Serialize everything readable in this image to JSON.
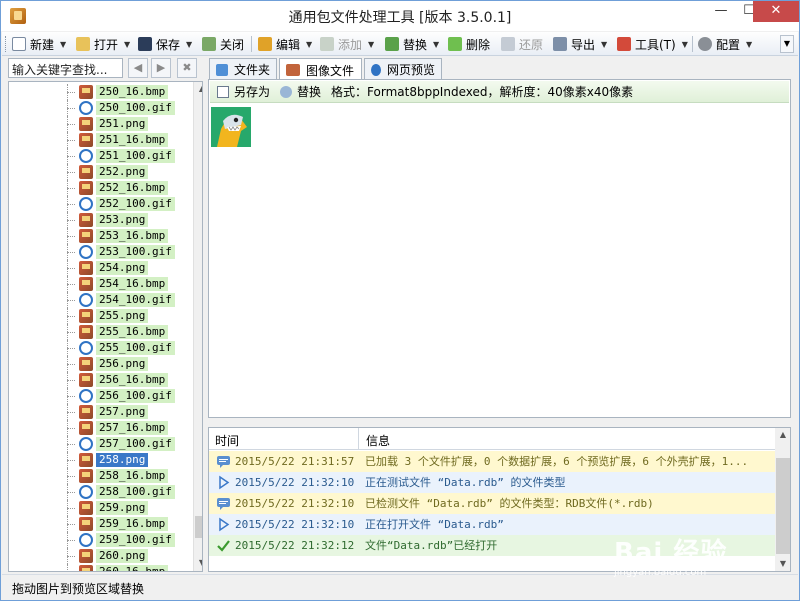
{
  "window": {
    "title": "通用包文件处理工具 [版本 3.5.0.1]",
    "minimize_glyph": "—",
    "maximize_glyph": "☐",
    "close_glyph": "✕"
  },
  "toolbar": {
    "new": "新建",
    "open": "打开",
    "save": "保存",
    "close": "关闭",
    "edit": "编辑",
    "add": "添加",
    "replace": "替换",
    "delete": "删除",
    "restore": "还原",
    "export": "导出",
    "tools": "工具(T)",
    "config": "配置",
    "dropdown_glyph": "▼"
  },
  "search": {
    "placeholder": "输入关键字查找...",
    "back_glyph": "◀",
    "forward_glyph": "▶",
    "clear_glyph": "✖"
  },
  "tree": {
    "items": [
      {
        "name": "250_16.bmp",
        "type": "bmp"
      },
      {
        "name": "250_100.gif",
        "type": "gif"
      },
      {
        "name": "251.png",
        "type": "png"
      },
      {
        "name": "251_16.bmp",
        "type": "bmp"
      },
      {
        "name": "251_100.gif",
        "type": "gif"
      },
      {
        "name": "252.png",
        "type": "png"
      },
      {
        "name": "252_16.bmp",
        "type": "bmp"
      },
      {
        "name": "252_100.gif",
        "type": "gif"
      },
      {
        "name": "253.png",
        "type": "png"
      },
      {
        "name": "253_16.bmp",
        "type": "bmp"
      },
      {
        "name": "253_100.gif",
        "type": "gif"
      },
      {
        "name": "254.png",
        "type": "png"
      },
      {
        "name": "254_16.bmp",
        "type": "bmp"
      },
      {
        "name": "254_100.gif",
        "type": "gif"
      },
      {
        "name": "255.png",
        "type": "png"
      },
      {
        "name": "255_16.bmp",
        "type": "bmp"
      },
      {
        "name": "255_100.gif",
        "type": "gif"
      },
      {
        "name": "256.png",
        "type": "png"
      },
      {
        "name": "256_16.bmp",
        "type": "bmp"
      },
      {
        "name": "256_100.gif",
        "type": "gif"
      },
      {
        "name": "257.png",
        "type": "png"
      },
      {
        "name": "257_16.bmp",
        "type": "bmp"
      },
      {
        "name": "257_100.gif",
        "type": "gif"
      },
      {
        "name": "258.png",
        "type": "png",
        "selected": true
      },
      {
        "name": "258_16.bmp",
        "type": "bmp"
      },
      {
        "name": "258_100.gif",
        "type": "gif"
      },
      {
        "name": "259.png",
        "type": "png"
      },
      {
        "name": "259_16.bmp",
        "type": "bmp"
      },
      {
        "name": "259_100.gif",
        "type": "gif"
      },
      {
        "name": "260.png",
        "type": "png"
      },
      {
        "name": "260_16.bmp",
        "type": "bmp"
      }
    ],
    "scroll_up_glyph": "▲",
    "scroll_down_glyph": "▼"
  },
  "tabs": [
    {
      "label": "文件夹",
      "icon": "folder-icon",
      "active": false
    },
    {
      "label": "图像文件",
      "icon": "image-icon",
      "active": true
    },
    {
      "label": "网页预览",
      "icon": "globe-icon",
      "active": false
    }
  ],
  "image_bar": {
    "save_as": "另存为",
    "replace": "替换",
    "info": "格式：Format8bppIndexed，解析度：40像素x40像素"
  },
  "log": {
    "col_time": "时间",
    "col_info": "信息",
    "rows": [
      {
        "time": "2015/5/22 21:31:57",
        "msg": "已加载 3 个文件扩展，0 个数据扩展，6 个预览扩展，6 个外壳扩展，1...",
        "kind": "yellow",
        "icon": "message-icon"
      },
      {
        "time": "2015/5/22 21:32:10",
        "msg": "正在测试文件 “Data.rdb” 的文件类型",
        "kind": "blue",
        "icon": "play-icon"
      },
      {
        "time": "2015/5/22 21:32:10",
        "msg": "已检测文件 “Data.rdb” 的文件类型：RDB文件(*.rdb)",
        "kind": "yellow",
        "icon": "message-icon"
      },
      {
        "time": "2015/5/22 21:32:10",
        "msg": "正在打开文件 “Data.rdb”",
        "kind": "blue",
        "icon": "play-icon"
      },
      {
        "time": "2015/5/22 21:32:12",
        "msg": "文件“Data.rdb”已经打开",
        "kind": "green",
        "icon": "check-icon"
      }
    ],
    "scroll_up_glyph": "▲",
    "scroll_down_glyph": "▼"
  },
  "status": {
    "text": "拖动图片到预览区域替换"
  },
  "watermark": {
    "brand": "Bai 经验",
    "url": "jingyan.baidu.com"
  },
  "colors": {
    "file_label_bg": "#d3f0c4",
    "selected_bg": "#3a78c8",
    "log_yellow": "#fff8cf",
    "log_blue": "#eaf2fc",
    "log_green": "#e7f6e1"
  }
}
